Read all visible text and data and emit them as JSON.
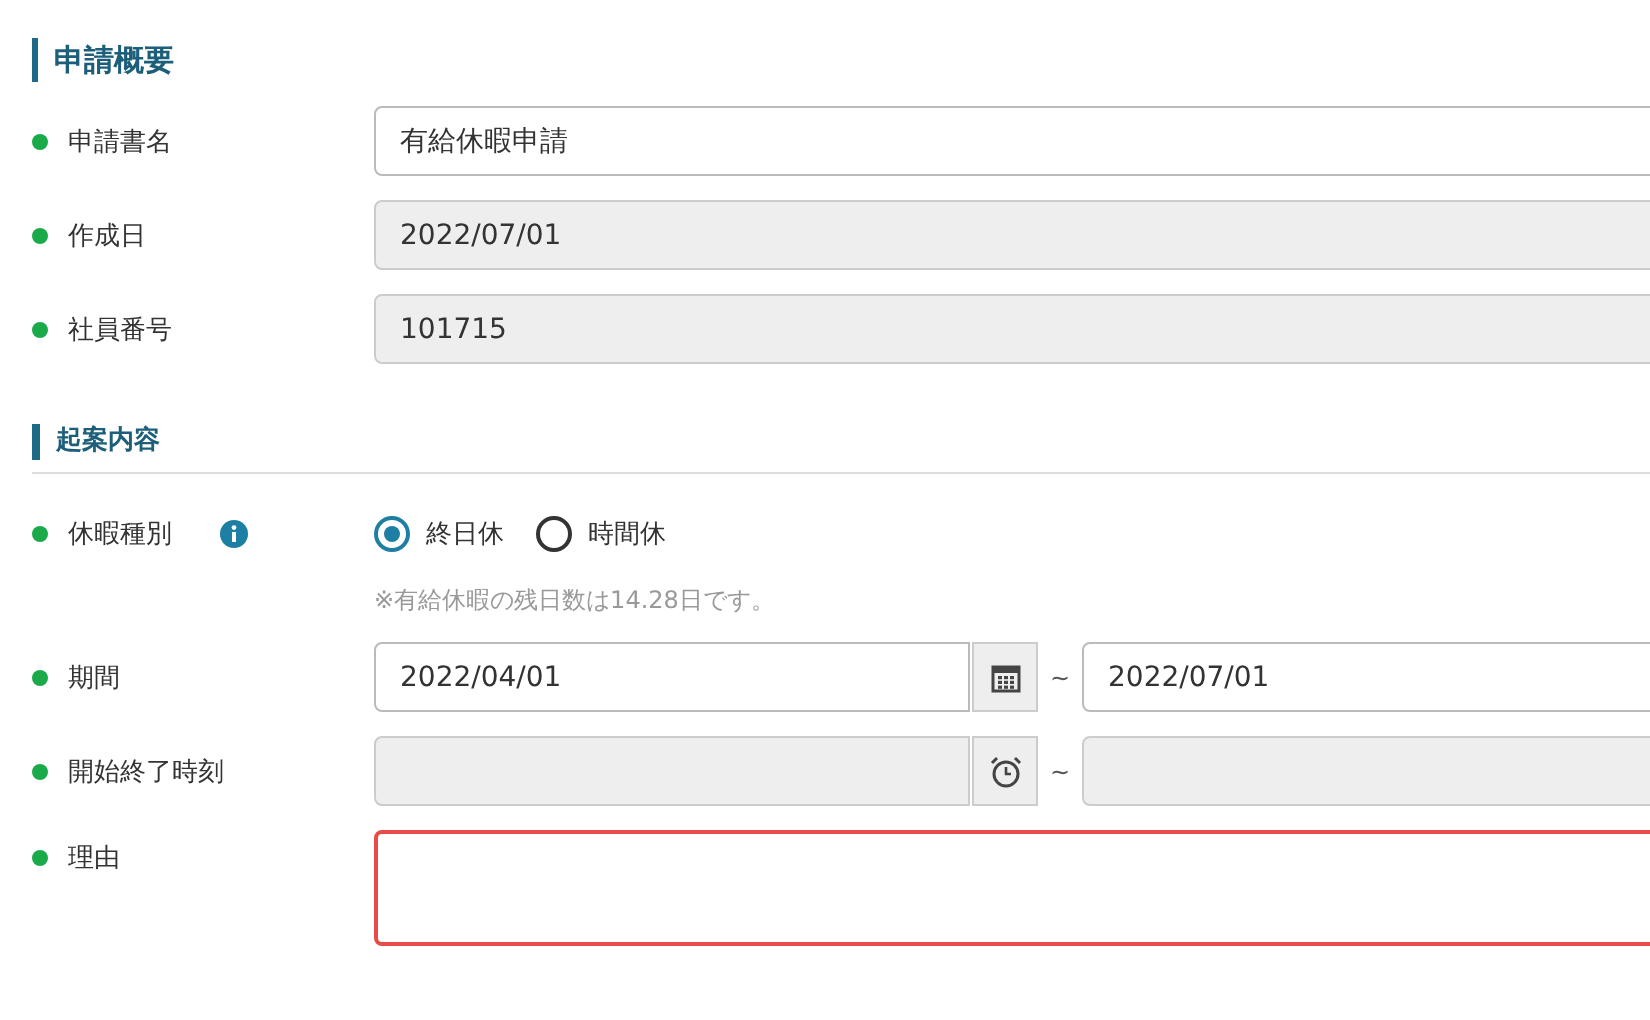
{
  "sections": [
    {
      "title": "申請概要",
      "rows": [
        {
          "kind": "text",
          "label": "申請書名",
          "value": "有給休暇申請",
          "disabled": false
        },
        {
          "kind": "text",
          "label": "作成日",
          "value": "2022/07/01",
          "disabled": true
        },
        {
          "kind": "text",
          "label": "社員番号",
          "value": "101715",
          "disabled": true
        }
      ]
    },
    {
      "title": "起案内容",
      "rows": [
        {
          "kind": "radio",
          "label": "休暇種別",
          "info": true,
          "options": [
            {
              "label": "終日休",
              "selected": true
            },
            {
              "label": "時間休",
              "selected": false
            }
          ],
          "note": "※有給休暇の残日数は14.28日です。"
        },
        {
          "kind": "date_range",
          "label": "期間",
          "separator": "~",
          "from": {
            "value": "2022/04/01",
            "disabled": false
          },
          "to": {
            "value": "2022/07/01",
            "disabled": false
          }
        },
        {
          "kind": "time_range",
          "label": "開始終了時刻",
          "separator": "~",
          "from": {
            "disabled": true
          },
          "to": {
            "disabled": true
          }
        },
        {
          "kind": "textarea",
          "label": "理由",
          "invalid": true
        }
      ]
    }
  ]
}
